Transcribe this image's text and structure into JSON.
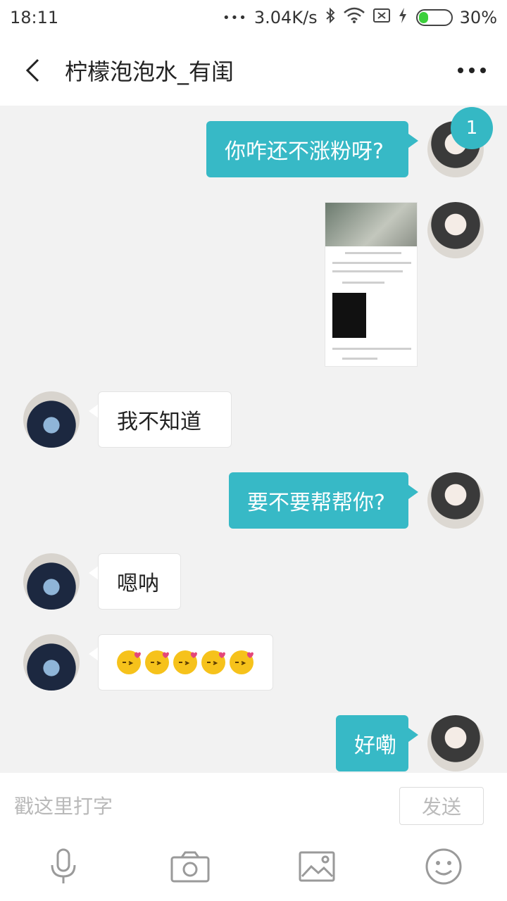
{
  "status_bar": {
    "time": "18:11",
    "dots": "•••",
    "speed": "3.04K/s",
    "battery_percent_label": "30%",
    "battery_level": 0.3,
    "battery_color": "#3ccf3c"
  },
  "header": {
    "title": "柠檬泡泡水_有闺"
  },
  "messages": [
    {
      "sender": "me",
      "type": "text",
      "text": "你咋还不涨粉呀?",
      "unread_badge": "1"
    },
    {
      "sender": "me",
      "type": "image"
    },
    {
      "sender": "other",
      "type": "text",
      "text": "我不知道"
    },
    {
      "sender": "me",
      "type": "text",
      "text": "要不要帮帮你?"
    },
    {
      "sender": "other",
      "type": "text",
      "text": "嗯呐"
    },
    {
      "sender": "other",
      "type": "emoji",
      "emoji_name": "kiss-face-emoji",
      "count": 5
    },
    {
      "sender": "me",
      "type": "text",
      "text": "好嘞"
    }
  ],
  "input": {
    "placeholder": "戳这里打字",
    "value": "",
    "send_label": "发送"
  },
  "toolbar": {
    "icons": [
      "microphone-icon",
      "camera-icon",
      "image-icon",
      "emoji-icon"
    ]
  },
  "colors": {
    "accent": "#37b9c6",
    "chat_bg": "#f2f2f2",
    "other_bubble": "#ffffff"
  }
}
